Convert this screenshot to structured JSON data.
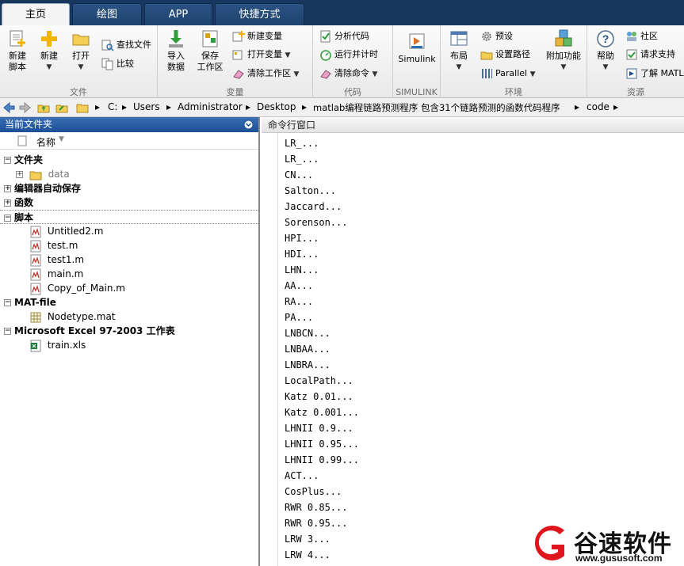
{
  "tabs": [
    "主页",
    "绘图",
    "APP",
    "快捷方式"
  ],
  "toolstrip": {
    "file": {
      "label": "文件",
      "new_script": "新建\n脚本",
      "new": "新建",
      "open": "打开",
      "find_files": "查找文件",
      "compare": "比较"
    },
    "variable": {
      "label": "变量",
      "import_data": "导入\n数据",
      "save_workspace": "保存\n工作区",
      "new_variable": "新建变量",
      "open_variable": "打开变量",
      "clear_workspace": "清除工作区"
    },
    "code": {
      "label": "代码",
      "analyze_code": "分析代码",
      "run_time": "运行并计时",
      "clear_commands": "清除命令"
    },
    "simulink": {
      "label": "SIMULINK",
      "simulink": "Simulink"
    },
    "environment": {
      "label": "环境",
      "layout": "布局",
      "preferences": "预设",
      "set_path": "设置路径",
      "parallel": "Parallel",
      "addons": "附加功能"
    },
    "resources": {
      "label": "资源",
      "help": "帮助",
      "community": "社区",
      "request_support": "请求支持",
      "learn_matlab": "了解 MATL"
    }
  },
  "address": {
    "crumbs": [
      "C:",
      "Users",
      "Administrator",
      "Desktop",
      "matlab编程链路预测程序 包含31个链路预测的函数代码程序",
      "code"
    ]
  },
  "current_folder": {
    "title": "当前文件夹",
    "name_column": "名称",
    "groups": [
      {
        "label": "文件夹",
        "items": [
          "data"
        ]
      },
      {
        "label": "编辑器自动保存",
        "items": []
      },
      {
        "label": "函数",
        "items": []
      },
      {
        "label": "脚本",
        "items": [
          "Untitled2.m",
          "test.m",
          "test1.m",
          "main.m",
          "Copy_of_Main.m"
        ]
      },
      {
        "label": "MAT-file",
        "items": [
          "Nodetype.mat"
        ]
      },
      {
        "label": "Microsoft Excel 97-2003 工作表",
        "items": [
          "train.xls"
        ]
      }
    ]
  },
  "command_window": {
    "title": "命令行窗口",
    "lines": [
      "LR_...",
      "LR_...",
      "CN...",
      "Salton...",
      "Jaccard...",
      "Sorenson...",
      "HPI...",
      "HDI...",
      "LHN...",
      "AA...",
      "RA...",
      "PA...",
      "LNBCN...",
      "LNBAA...",
      "LNBRA...",
      "LocalPath...",
      "Katz 0.01...",
      "Katz 0.001...",
      "LHNII 0.9...",
      "LHNII 0.95...",
      "LHNII 0.99...",
      "ACT...",
      "CosPlus...",
      "RWR 0.85...",
      "RWR 0.95...",
      "LRW 3...",
      "LRW 4..."
    ]
  },
  "watermark": {
    "name": "谷速软件",
    "url": "www.gususoft.com"
  }
}
